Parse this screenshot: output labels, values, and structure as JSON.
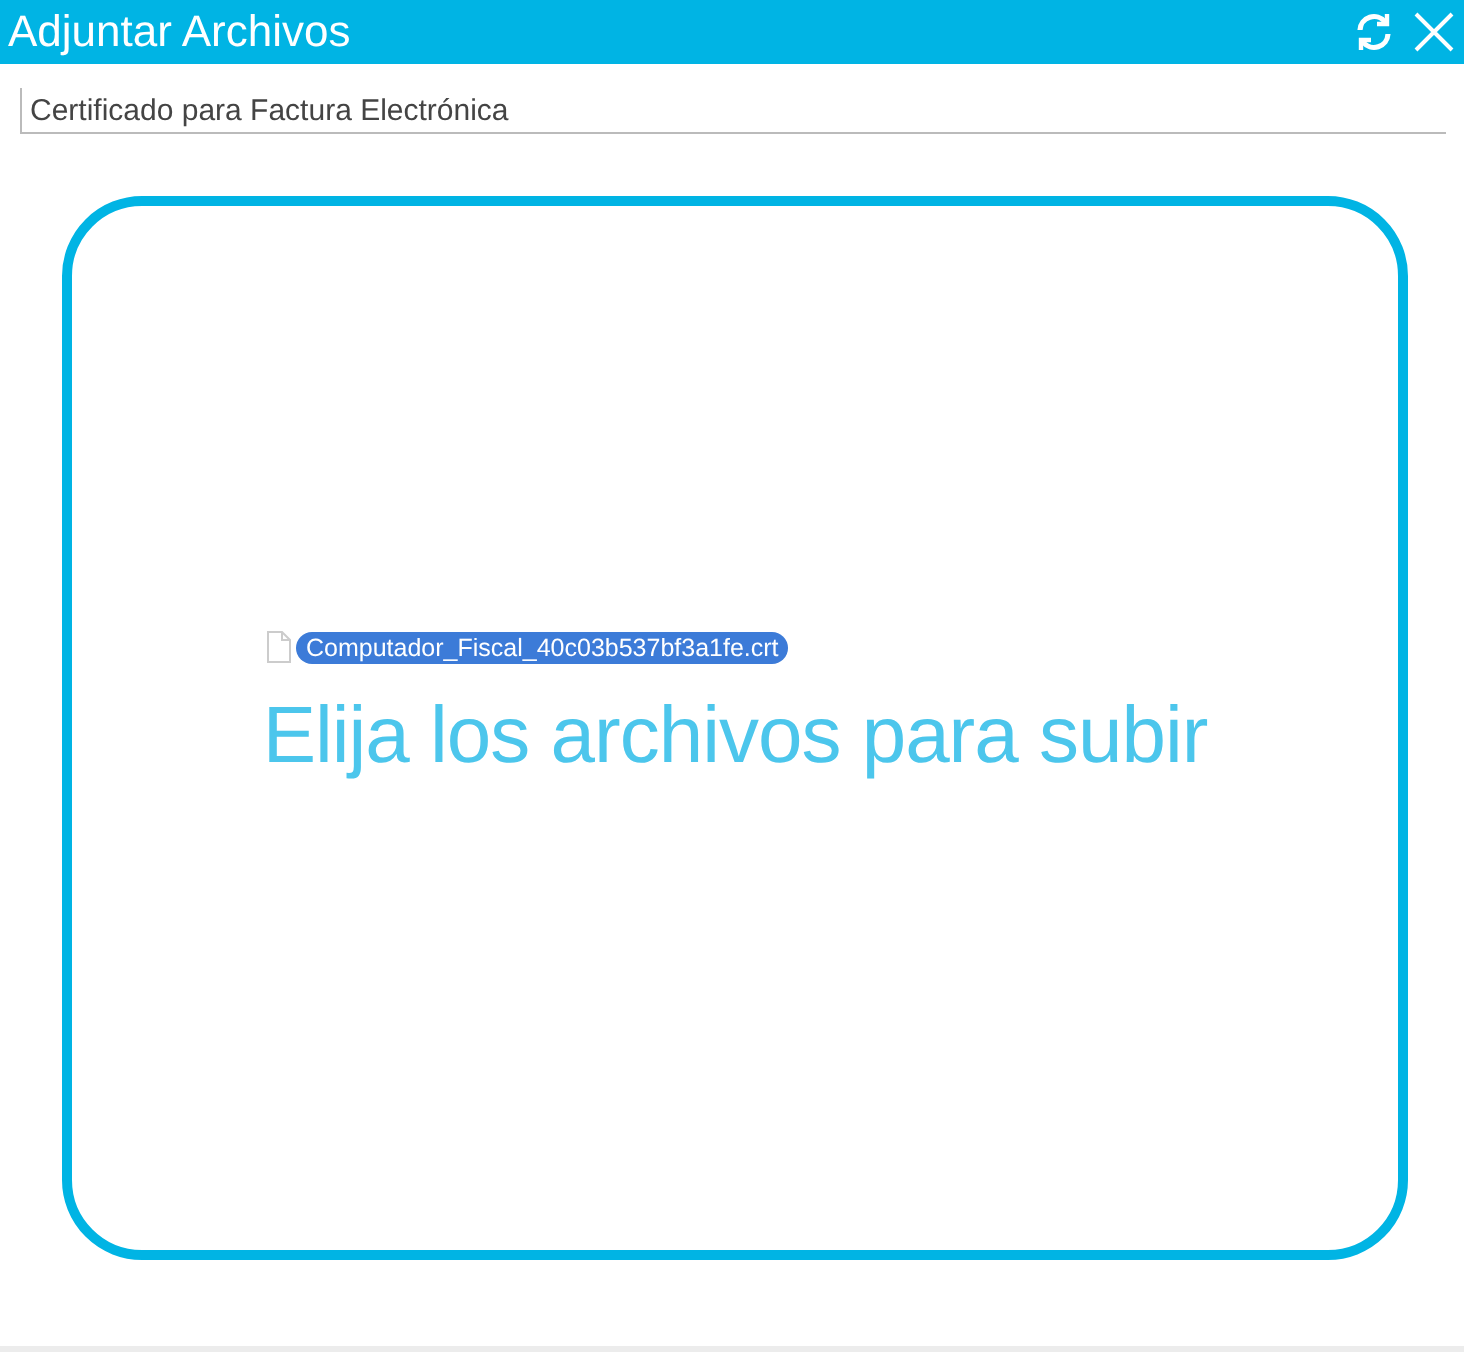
{
  "window": {
    "title": "Adjuntar Archivos"
  },
  "description_field": {
    "value": "Certificado para Factura Electrónica"
  },
  "drop_zone": {
    "files": [
      {
        "name": "Computador_Fiscal_40c03b537bf3a1fe.crt",
        "selected": true
      }
    ],
    "prompt": "Elija los archivos para subir"
  }
}
